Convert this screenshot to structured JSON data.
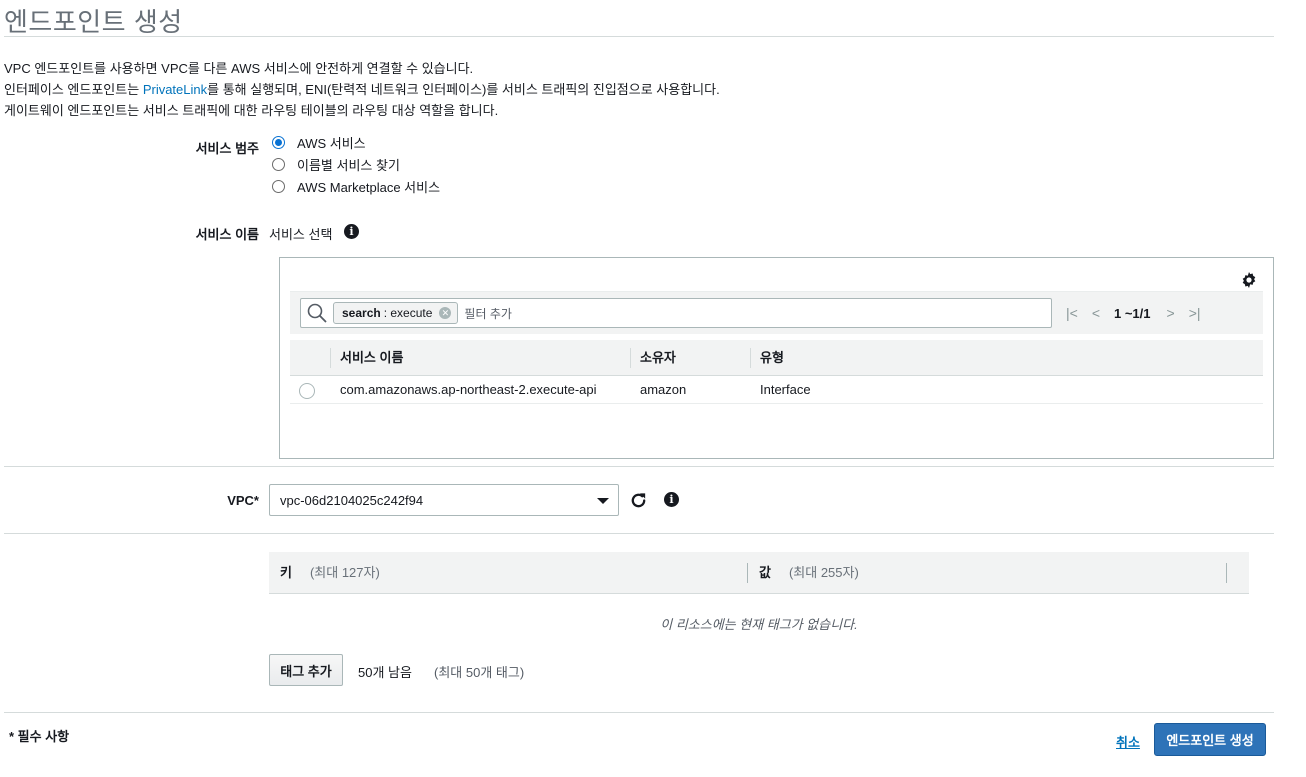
{
  "page": {
    "title": "엔드포인트 생성",
    "desc_line1": "VPC 엔드포인트를 사용하면 VPC를 다른 AWS 서비스에 안전하게 연결할 수 있습니다.",
    "desc_line2_prefix": "인터페이스 엔드포인트는",
    "desc_line2_link": "PrivateLink",
    "desc_line2_suffix": "를 통해 실행되며, ENI(탄력적 네트워크 인터페이스)를 서비스 트래픽의 진입점으로 사용합니다.",
    "desc_line3": "게이트웨이 엔드포인트는 서비스 트래픽에 대한 라우팅 테이블의 라우팅 대상 역할을 합니다."
  },
  "service_category": {
    "label": "서비스 범주",
    "options": [
      {
        "label": "AWS 서비스",
        "selected": true
      },
      {
        "label": "이름별 서비스 찾기",
        "selected": false
      },
      {
        "label": "AWS Marketplace 서비스",
        "selected": false
      }
    ]
  },
  "service_name": {
    "label": "서비스 이름",
    "value": "서비스 선택",
    "info_icon": "info-icon"
  },
  "service_table": {
    "filter": {
      "token_key": "search",
      "token_value": ": execute",
      "placeholder": "필터 추가"
    },
    "pagination": "1 ~1/1",
    "columns": [
      "서비스 이름",
      "소유자",
      "유형"
    ],
    "rows": [
      {
        "name": "com.amazonaws.ap-northeast-2.execute-api",
        "owner": "amazon",
        "type": "Interface",
        "selected": false
      }
    ],
    "settings_icon": "gear-icon"
  },
  "vpc": {
    "label": "VPC*",
    "value": "vpc-06d2104025c242f94",
    "refresh_icon": "refresh-icon",
    "info_icon": "info-icon"
  },
  "tags": {
    "key_label": "키",
    "key_hint": "(최대 127자)",
    "value_label": "값",
    "value_hint": "(최대 255자)",
    "empty_message": "이 리소스에는 현재 태그가 없습니다.",
    "add_button": "태그 추가",
    "remaining": "50개 남음",
    "remaining_hint": "(최대 50개 태그)"
  },
  "footer": {
    "required_note": "* 필수 사항",
    "cancel_label": "취소",
    "create_label": "엔드포인트 생성"
  },
  "colors": {
    "primary_button": "#2e73b8",
    "link": "#0073bb",
    "radio_selected": "#0972d3"
  }
}
